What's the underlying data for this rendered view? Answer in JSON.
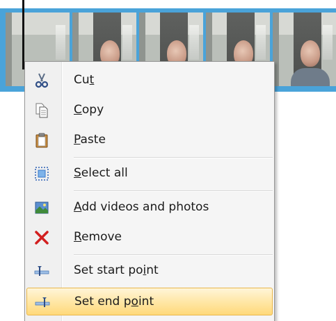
{
  "context_menu": {
    "items": [
      {
        "pre": "Cu",
        "key": "t",
        "post": "",
        "icon": "scissors-icon"
      },
      {
        "pre": "",
        "key": "C",
        "post": "opy",
        "icon": "copy-icon"
      },
      {
        "pre": "",
        "key": "P",
        "post": "aste",
        "icon": "clipboard-icon"
      },
      {
        "pre": "",
        "key": "S",
        "post": "elect all",
        "icon": "select-all-icon"
      },
      {
        "pre": "",
        "key": "A",
        "post": "dd videos and photos",
        "icon": "add-media-icon"
      },
      {
        "pre": "",
        "key": "R",
        "post": "emove",
        "icon": "remove-x-icon"
      },
      {
        "pre": "Set start po",
        "key": "i",
        "post": "nt",
        "icon": "set-start-point-icon"
      },
      {
        "pre": "Set end p",
        "key": "o",
        "post": "int",
        "icon": "set-end-point-icon"
      }
    ],
    "selected_item": "Set end point"
  },
  "colors": {
    "timeline_track": "#4aa3d9",
    "menu_background": "#f5f5f5",
    "highlight_border": "#e8b64a",
    "remove_icon": "#d21f1f"
  }
}
